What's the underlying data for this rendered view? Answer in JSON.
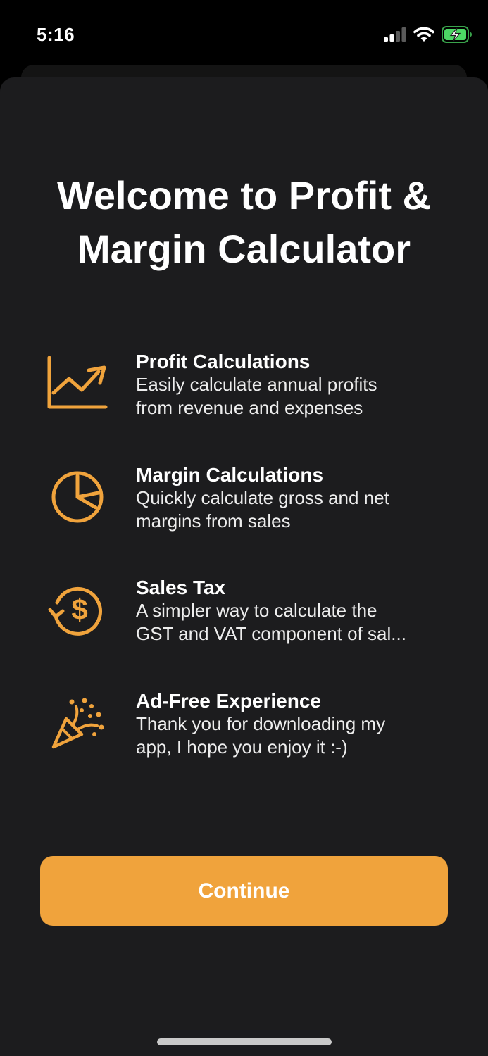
{
  "status_bar": {
    "time": "5:16",
    "signal_icon": "cellular-signal-icon",
    "wifi_icon": "wifi-icon",
    "battery_icon": "battery-charging-icon"
  },
  "welcome": {
    "title": "Welcome to Profit & Margin Calculator"
  },
  "features": [
    {
      "icon": "line-chart-icon",
      "title": "Profit Calculations",
      "desc_lines": [
        "Easily calculate annual profits",
        "from revenue and expenses"
      ]
    },
    {
      "icon": "pie-chart-icon",
      "title": "Margin Calculations",
      "desc_lines": [
        "Quickly calculate gross and net",
        "margins from sales"
      ]
    },
    {
      "icon": "dollar-refresh-icon",
      "title": "Sales Tax",
      "desc_lines": [
        "A simpler way to calculate the",
        "GST and VAT component of sal..."
      ]
    },
    {
      "icon": "party-popper-icon",
      "title": "Ad-Free Experience",
      "desc_lines": [
        "Thank you for downloading my",
        "app, I hope you enjoy it :-)"
      ]
    }
  ],
  "actions": {
    "continue_label": "Continue"
  },
  "colors": {
    "accent": "#f0a33c",
    "sheet_background": "#1c1c1e",
    "battery_fill": "#4cd964"
  }
}
